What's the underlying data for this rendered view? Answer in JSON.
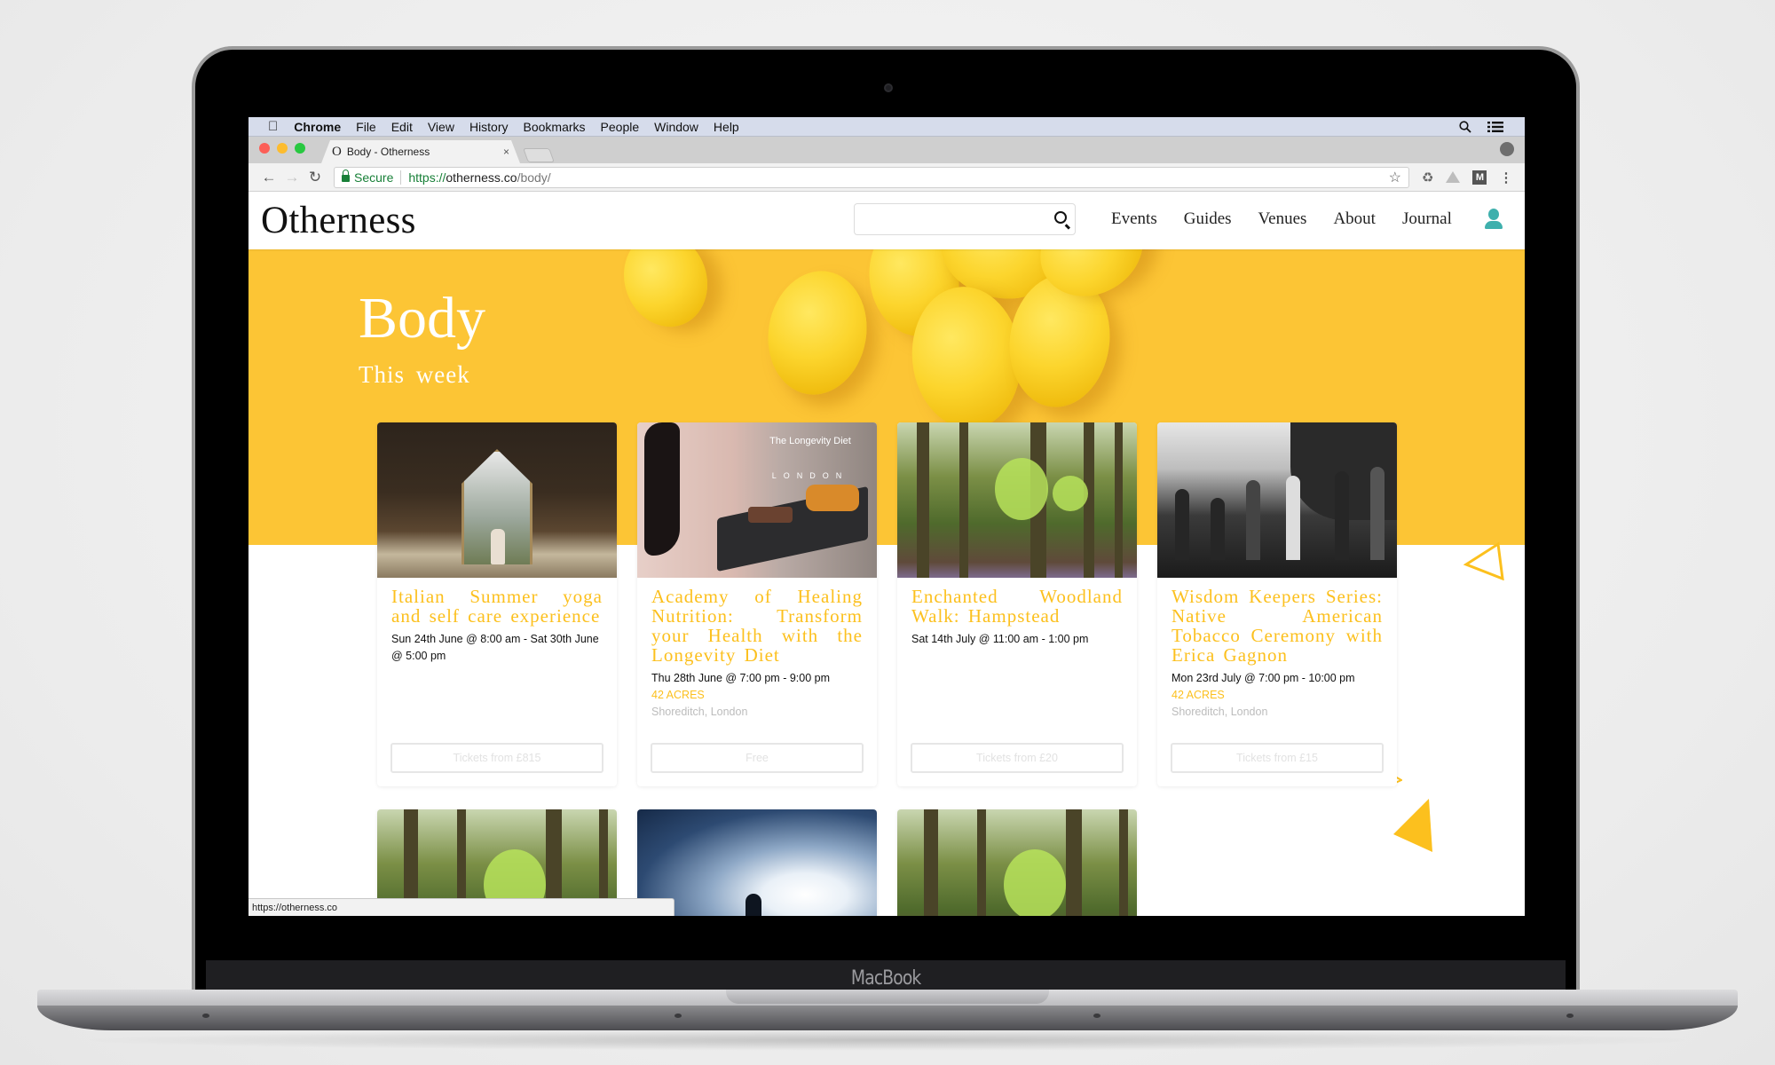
{
  "device": {
    "brand_label": "MacBook"
  },
  "macos_menubar": {
    "app_name": "Chrome",
    "items": [
      "File",
      "Edit",
      "View",
      "History",
      "Bookmarks",
      "People",
      "Window",
      "Help"
    ]
  },
  "browser": {
    "tab": {
      "title": "Body - Otherness",
      "favicon": "O",
      "close": "×"
    },
    "url": {
      "secure_label": "Secure",
      "scheme": "https://",
      "host": "otherness.co",
      "path": "/body/"
    },
    "status_url": "https://otherness.co",
    "icons": [
      "back-icon",
      "forward-icon",
      "reload-icon",
      "lock-icon",
      "bookmark-star-icon",
      "recycle-extension-icon",
      "drive-extension-icon",
      "m-extension-icon",
      "menu-kebab-icon",
      "profile-icon"
    ]
  },
  "site": {
    "logo": "Otherness",
    "search": {
      "placeholder": "",
      "value": ""
    },
    "nav": [
      "Events",
      "Guides",
      "Venues",
      "About",
      "Journal"
    ],
    "accent_color": "#fcc01e",
    "hero_color": "#fcc535",
    "user_icon_color": "#3fb0ad"
  },
  "hero": {
    "title": "Body",
    "subtitle": "This week"
  },
  "cards": [
    {
      "title": "Italian Summer yoga and self care experience",
      "date": "Sun 24th June @ 8:00 am - Sat 30th June @ 5:00 pm",
      "venue": "",
      "location": "",
      "button": "Tickets from £815",
      "image": "glass chapel in forest"
    },
    {
      "title": "Academy of Healing Nutrition: Transform your Health with the Longevity Diet",
      "date": "Thu 28th June @ 7:00 pm - 9:00 pm",
      "venue": "42 ACRES",
      "location": "Shoreditch, London",
      "button": "Free",
      "image": "food on slate platter",
      "image_overlay_title": "The Longevity Diet",
      "image_overlay_sub": "LONDON"
    },
    {
      "title": "Enchanted Woodland Walk: Hampstead",
      "date": "Sat 14th July @ 11:00 am - 1:00 pm",
      "venue": "",
      "location": "",
      "button": "Tickets from £20",
      "image": "beech woodland"
    },
    {
      "title": "Wisdom Keepers Series: Native American Tobacco Ceremony with Erica Gagnon",
      "date": "Mon 23rd July @ 7:00 pm - 10:00 pm",
      "venue": "42 ACRES",
      "location": "Shoreditch, London",
      "button": "Tickets from £15",
      "image": "black and white ceremony gathering"
    }
  ],
  "second_row_images": [
    "beech woodland",
    "figure under bright clouds",
    "beech woodland"
  ]
}
